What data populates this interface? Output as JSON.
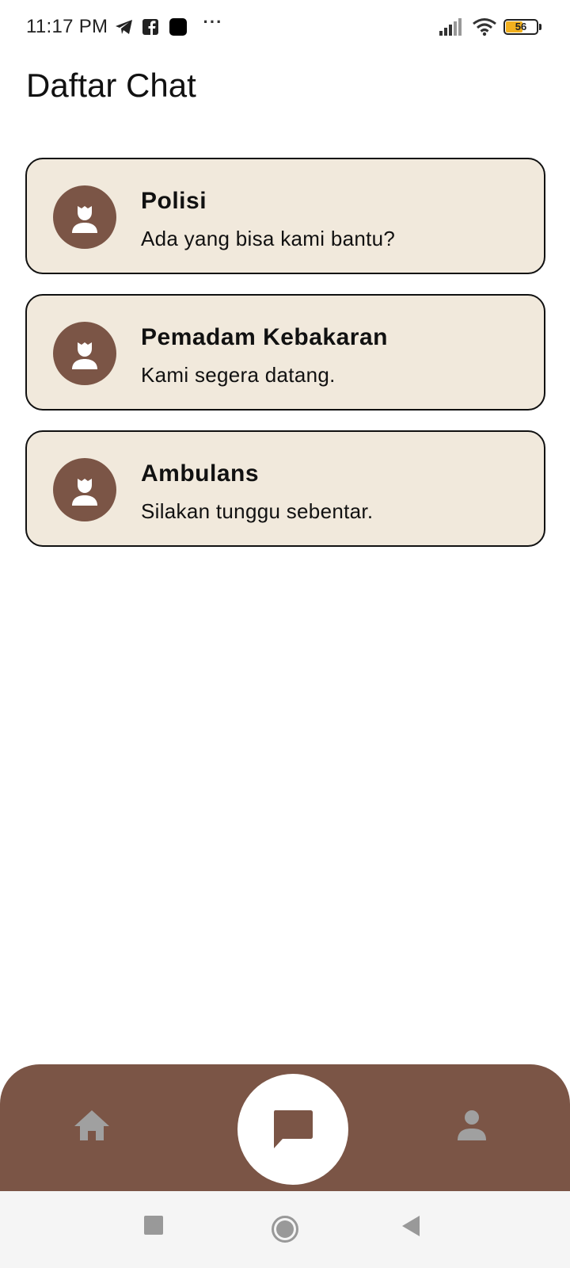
{
  "status_bar": {
    "time": "11:17 PM",
    "battery_level": "56",
    "battery_fraction": 0.56,
    "icons": [
      "telegram-icon",
      "facebook-icon",
      "app-icon",
      "more-icon",
      "signal-icon",
      "wifi-icon",
      "battery-icon"
    ]
  },
  "page": {
    "title": "Daftar Chat"
  },
  "chats": [
    {
      "name": "Polisi",
      "message": "Ada yang bisa kami bantu?",
      "icon": "person-icon"
    },
    {
      "name": "Pemadam Kebakaran",
      "message": "Kami segera datang.",
      "icon": "person-icon"
    },
    {
      "name": "Ambulans",
      "message": "Silakan tunggu sebentar.",
      "icon": "person-icon"
    }
  ],
  "bottom_nav": {
    "items": [
      "home-icon",
      "chat-icon",
      "profile-icon"
    ],
    "active": "chat-icon"
  },
  "system_nav": {
    "buttons": [
      "recents-icon",
      "home-icon",
      "back-icon"
    ]
  },
  "colors": {
    "accent": "#7b5546",
    "card_background": "#f1e9dc",
    "inactive_nav_icon": "#a0a0a0"
  }
}
